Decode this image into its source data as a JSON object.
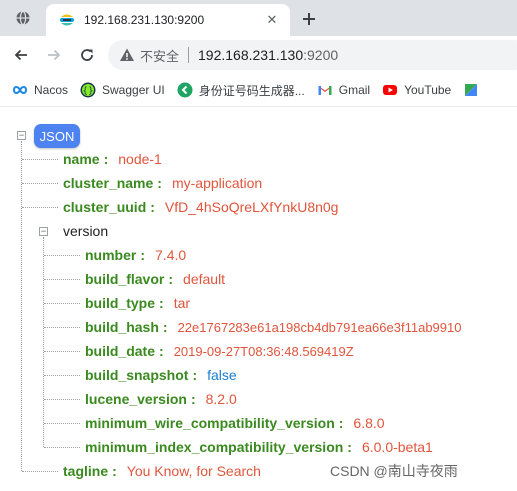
{
  "browser": {
    "tab_title": "192.168.231.130:9200",
    "url_security_label": "不安全",
    "url_host": "192.168.231.130",
    "url_port": ":9200",
    "bookmarks": [
      {
        "label": "Nacos",
        "icon": "nacos-icon"
      },
      {
        "label": "Swagger UI",
        "icon": "swagger-icon"
      },
      {
        "label": "身份证号码生成器...",
        "icon": "idcard-generator-icon"
      },
      {
        "label": "Gmail",
        "icon": "gmail-icon"
      },
      {
        "label": "YouTube",
        "icon": "youtube-icon"
      }
    ],
    "colors": {
      "tabstrip": "#dee1e6",
      "omnibox": "#f1f3f4"
    }
  },
  "json_viewer": {
    "root_label": "JSON",
    "fields": {
      "name": {
        "key": "name",
        "value": "node-1"
      },
      "cluster_name": {
        "key": "cluster_name",
        "value": "my-application"
      },
      "cluster_uuid": {
        "key": "cluster_uuid",
        "value": "VfD_4hSoQreLXfYnkU8n0g"
      },
      "tagline": {
        "key": "tagline",
        "value": "You Know, for Search"
      }
    },
    "version": {
      "key": "version",
      "fields": {
        "number": {
          "key": "number",
          "value": "7.4.0"
        },
        "build_flavor": {
          "key": "build_flavor",
          "value": "default"
        },
        "build_type": {
          "key": "build_type",
          "value": "tar"
        },
        "build_hash": {
          "key": "build_hash",
          "value": "22e1767283e61a198cb4db791ea66e3f11ab9910"
        },
        "build_date": {
          "key": "build_date",
          "value": "2019-09-27T08:36:48.569419Z"
        },
        "build_snapshot": {
          "key": "build_snapshot",
          "value": "false"
        },
        "lucene_version": {
          "key": "lucene_version",
          "value": "8.2.0"
        },
        "minimum_wire_compatibility_version": {
          "key": "minimum_wire_compatibility_version",
          "value": "6.8.0"
        },
        "minimum_index_compatibility_version": {
          "key": "minimum_index_compatibility_version",
          "value": "6.0.0-beta1"
        }
      }
    },
    "colors": {
      "key": "#3a8a1f",
      "string_value": "#e0553c",
      "boolean_value": "#1a7ecf",
      "root_badge": "#4c83f0"
    }
  },
  "watermark": "CSDN @南山寺夜雨"
}
